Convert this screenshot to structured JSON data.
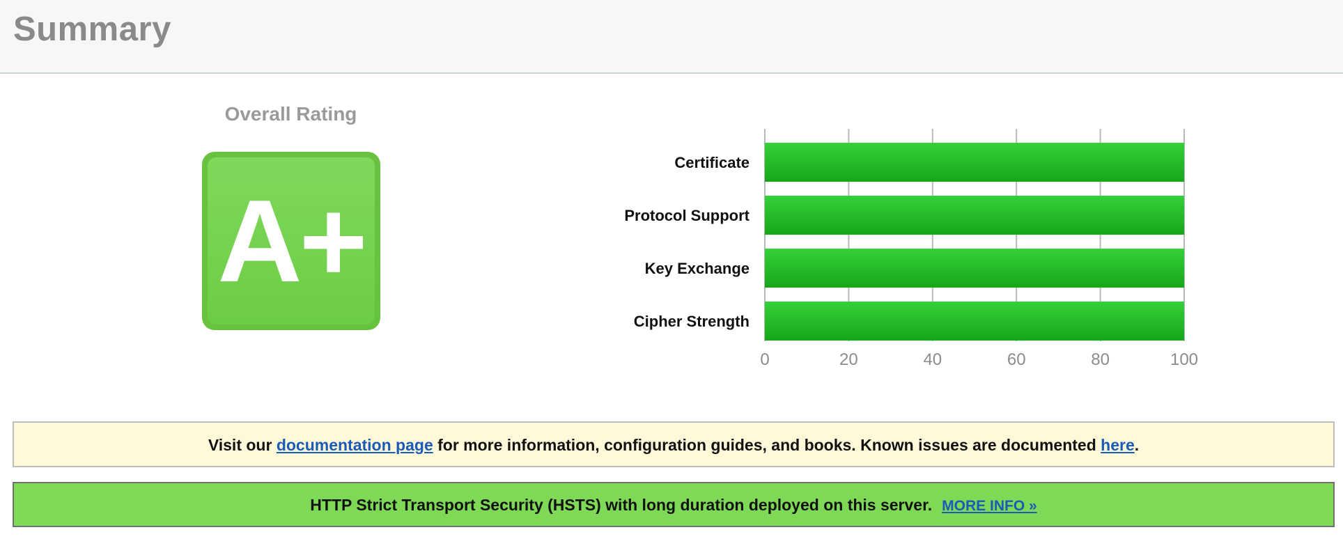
{
  "header": {
    "title": "Summary"
  },
  "rating": {
    "label": "Overall Rating",
    "grade": "A+"
  },
  "chart_data": {
    "type": "bar",
    "orientation": "horizontal",
    "categories": [
      "Certificate",
      "Protocol Support",
      "Key Exchange",
      "Cipher Strength"
    ],
    "values": [
      100,
      100,
      100,
      100
    ],
    "xlim": [
      0,
      100
    ],
    "xticks": [
      "0",
      "20",
      "40",
      "60",
      "80",
      "100"
    ],
    "grid": true,
    "bar_color": "#22b622"
  },
  "doc_banner": {
    "prefix": "Visit our ",
    "doc_link": "documentation page",
    "middle": " for more information, configuration guides, and books. Known issues are documented ",
    "here_link": "here",
    "suffix": "."
  },
  "hsts_banner": {
    "text": "HTTP Strict Transport Security (HSTS) with long duration deployed on this server.",
    "link": "MORE INFO »"
  },
  "colors": {
    "grade_green": "#6ccd45",
    "hsts_green": "#7ed957",
    "note_yellow": "#fff9d9",
    "link_blue": "#1a5bb8"
  }
}
